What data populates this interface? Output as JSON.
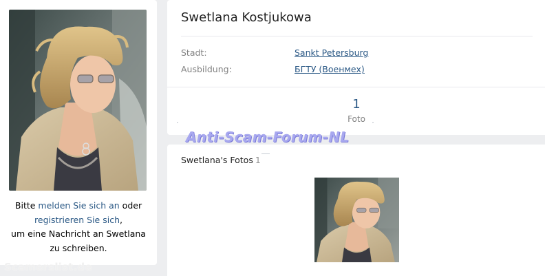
{
  "profile": {
    "name": "Swetlana Kostjukowa",
    "info": [
      {
        "label": "Stadt:",
        "value": "Sankt Petersburg"
      },
      {
        "label": "Ausbildung:",
        "value": "БГТУ (Военмех)"
      }
    ],
    "photo_count": "1",
    "photo_count_label": "Foto"
  },
  "login_note": {
    "prefix": "Bitte ",
    "login_link": "melden Sie sich an",
    "middle": " oder",
    "register_link": "registrieren Sie sich",
    "after_register": ",",
    "line3": "um eine Nachricht an Swetlana zu schreiben."
  },
  "photos": {
    "title": "Swetlana's Fotos",
    "count": "1"
  },
  "watermarks": {
    "center": "Anti-Scam-Forum-NL",
    "bottom_left": "Scamerslist.de"
  },
  "colors": {
    "page_bg": "#edeef0",
    "link": "#2a5885",
    "muted": "#828282",
    "watermark": "#a8a8ef"
  }
}
